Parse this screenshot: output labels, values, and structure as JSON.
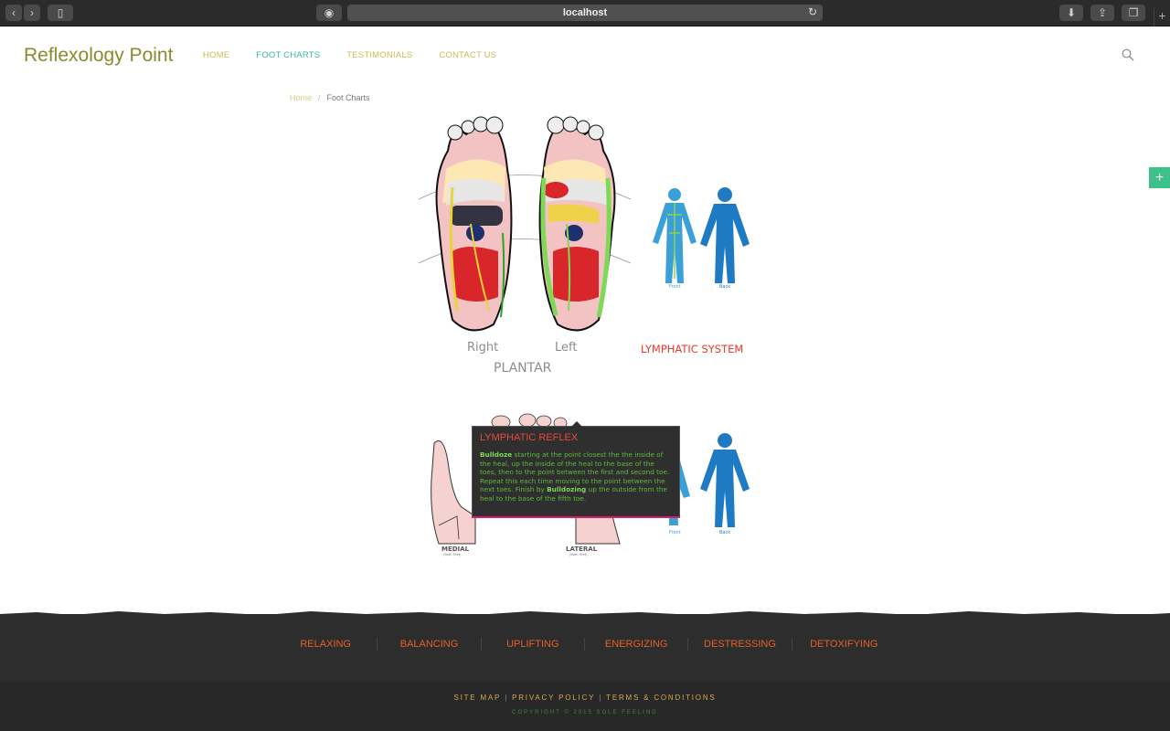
{
  "browser": {
    "url": "localhost"
  },
  "header": {
    "logo": "Reflexology Point",
    "nav": [
      {
        "label": "HOME"
      },
      {
        "label": "FOOT CHARTS"
      },
      {
        "label": "TESTIMONIALS"
      },
      {
        "label": "CONTACT US"
      }
    ]
  },
  "breadcrumb": {
    "home": "Home",
    "separator": "/",
    "current": "Foot Charts"
  },
  "side_button": "+",
  "chart": {
    "plantar": {
      "right_label": "Right",
      "left_label": "Left",
      "title": "PLANTAR"
    },
    "lymphatic_title": "LYMPHATIC SYSTEM",
    "figure_labels": {
      "front": "Front",
      "back": "Back"
    },
    "side_views": {
      "medial": "MEDIAL",
      "medial_sub": "(Both Feet)",
      "lateral": "LATERAL",
      "lateral_sub": "(Both Feet)"
    }
  },
  "tooltip": {
    "title": "LYMPHATIC REFLEX",
    "bold1": "Bulldoze",
    "text1": " starting at the point closest the the inside of the heal, up the inside of the heal to the base of the toes, then to the point between the first and second toe. Repeat this each time moving to the point between the next toes. Finish by ",
    "bold2": "Bulldozing",
    "text2": " up the outside from the heal to the base of the fifth toe."
  },
  "footer": {
    "moods": [
      "RELAXING",
      "BALANCING",
      "UPLIFTING",
      "ENERGIZING",
      "DESTRESSING",
      "DETOXIFYING"
    ],
    "links": [
      "SITE MAP",
      "PRIVACY POLICY",
      "TERMS & CONDITIONS"
    ],
    "link_separator": "|",
    "copyright": "COPYRIGHT © 2015 SOLE FEELING"
  },
  "colors": {
    "logo": "#8a8a2e",
    "nav": "#cdbb55",
    "nav_active": "#3cb4a0",
    "tooltip_title": "#e64a3c",
    "tooltip_text": "#5dbb3a",
    "mood_links": "#e2612a",
    "lymphatic_title": "#e63a2e",
    "side_button": "#3dc08a"
  }
}
